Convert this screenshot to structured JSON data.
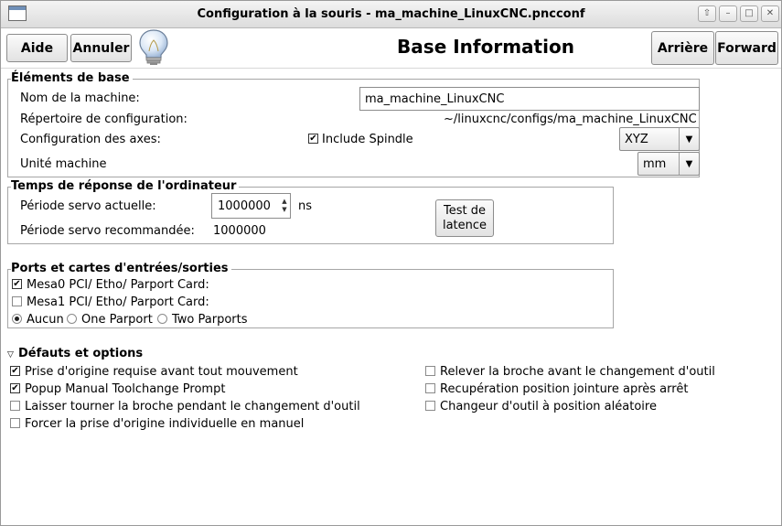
{
  "window": {
    "title": "Configuration à la souris - ma_machine_LinuxCNC.pncconf",
    "controls": {
      "shade_glyph": "⇧",
      "minimize_glyph": "–",
      "maximize_glyph": "□",
      "close_glyph": "✕"
    }
  },
  "toolbar": {
    "help_label": "Aide",
    "cancel_label": "Annuler",
    "page_title": "Base Information",
    "back_label": "Arrière",
    "forward_label": "Forward"
  },
  "basic": {
    "section_label": "Éléments de base",
    "machine_name_label": "Nom de la machine:",
    "machine_name_value": "ma_machine_LinuxCNC",
    "config_dir_label": "Répertoire de configuration:",
    "config_dir_value": "~/linuxcnc/configs/ma_machine_LinuxCNC",
    "axes_label": "Configuration des axes:",
    "include_spindle_label": "Include Spindle",
    "include_spindle_checked": true,
    "axes_value": "XYZ",
    "units_label": "Unité machine",
    "units_value": "mm"
  },
  "timing": {
    "section_label": "Temps de réponse de l'ordinateur",
    "servo_current_label": "Période servo actuelle:",
    "servo_current_value": "1000000",
    "servo_unit": "ns",
    "latency_button_line1": "Test de",
    "latency_button_line2": "latence",
    "servo_recommended_label": "Période servo recommandée:",
    "servo_recommended_value": "1000000"
  },
  "ports": {
    "section_label": "Ports et cartes d'entrées/sorties",
    "mesa0_label": "Mesa0 PCI/ Etho/ Parport Card:",
    "mesa0_checked": true,
    "mesa1_label": "Mesa1 PCI/ Etho/ Parport Card:",
    "mesa1_checked": false,
    "parport_options": [
      "Aucun",
      "One Parport",
      "Two Parports"
    ],
    "parport_selected": "Aucun"
  },
  "defaults": {
    "section_label": "Défauts et options",
    "expander_glyph": "▽",
    "options": [
      {
        "label": "Prise d'origine requise avant tout mouvement",
        "checked": true
      },
      {
        "label": "Popup Manual Toolchange Prompt",
        "checked": true
      },
      {
        "label": "Laisser tourner la broche pendant le changement d'outil",
        "checked": false
      },
      {
        "label": "Forcer la prise d'origine individuelle en manuel",
        "checked": false
      },
      {
        "label": "Relever la broche avant le changement d'outil",
        "checked": false
      },
      {
        "label": "Recupération position jointure après arrêt",
        "checked": false
      },
      {
        "label": "Changeur d'outil à position aléatoire",
        "checked": false
      }
    ]
  },
  "glyphs": {
    "check_mark": "✔",
    "combo_arrow": "▼",
    "spin_up": "▲",
    "spin_down": "▼"
  },
  "icons": {
    "app": "window-icon",
    "help": "lightbulb-icon"
  },
  "colors": {
    "background": "#ffffff",
    "frame_border": "#a6a6a6",
    "titlebar_top": "#f4f4f4",
    "titlebar_bottom": "#dcdcdc"
  }
}
